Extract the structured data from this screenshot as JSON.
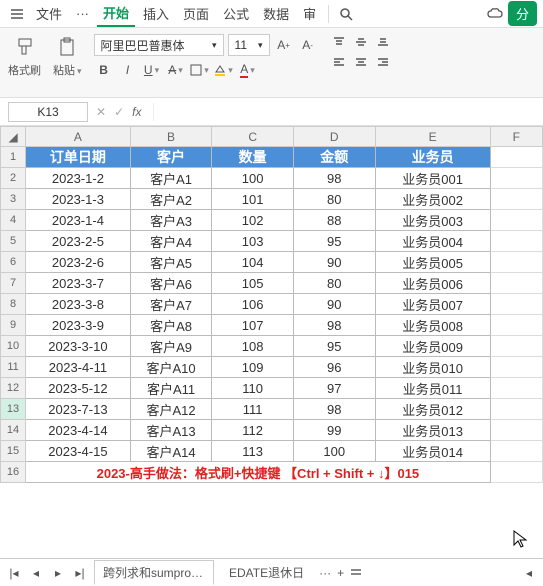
{
  "menu": {
    "items": [
      "文件",
      "···",
      "开始",
      "插入",
      "页面",
      "公式",
      "数据",
      "审"
    ],
    "active_index": 2
  },
  "greenbtn": "分",
  "toolbar": {
    "fmtbrush": "格式刷",
    "paste": "粘贴",
    "font_name": "阿里巴巴普惠体",
    "font_size": "11"
  },
  "namebox": "K13",
  "fx": "fx",
  "columns": [
    "A",
    "B",
    "C",
    "D",
    "E",
    "F"
  ],
  "headers": [
    "订单日期",
    "客户",
    "数量",
    "金额",
    "业务员"
  ],
  "rows": [
    {
      "n": "1"
    },
    {
      "n": "2",
      "a": "2023-1-2",
      "b": "客户A1",
      "c": "100",
      "d": "98",
      "e": "业务员001"
    },
    {
      "n": "3",
      "a": "2023-1-3",
      "b": "客户A2",
      "c": "101",
      "d": "80",
      "e": "业务员002"
    },
    {
      "n": "4",
      "a": "2023-1-4",
      "b": "客户A3",
      "c": "102",
      "d": "88",
      "e": "业务员003"
    },
    {
      "n": "5",
      "a": "2023-2-5",
      "b": "客户A4",
      "c": "103",
      "d": "95",
      "e": "业务员004"
    },
    {
      "n": "6",
      "a": "2023-2-6",
      "b": "客户A5",
      "c": "104",
      "d": "90",
      "e": "业务员005"
    },
    {
      "n": "7",
      "a": "2023-3-7",
      "b": "客户A6",
      "c": "105",
      "d": "80",
      "e": "业务员006"
    },
    {
      "n": "8",
      "a": "2023-3-8",
      "b": "客户A7",
      "c": "106",
      "d": "90",
      "e": "业务员007"
    },
    {
      "n": "9",
      "a": "2023-3-9",
      "b": "客户A8",
      "c": "107",
      "d": "98",
      "e": "业务员008"
    },
    {
      "n": "10",
      "a": "2023-3-10",
      "b": "客户A9",
      "c": "108",
      "d": "95",
      "e": "业务员009"
    },
    {
      "n": "11",
      "a": "2023-4-11",
      "b": "客户A10",
      "c": "109",
      "d": "96",
      "e": "业务员010"
    },
    {
      "n": "12",
      "a": "2023-5-12",
      "b": "客户A11",
      "c": "110",
      "d": "97",
      "e": "业务员011"
    },
    {
      "n": "13",
      "a": "2023-7-13",
      "b": "客户A12",
      "c": "111",
      "d": "98",
      "e": "业务员012"
    },
    {
      "n": "14",
      "a": "2023-4-14",
      "b": "客户A13",
      "c": "112",
      "d": "99",
      "e": "业务员013"
    },
    {
      "n": "15",
      "a": "2023-4-15",
      "b": "客户A14",
      "c": "113",
      "d": "100",
      "e": "业务员014"
    },
    {
      "n": "16",
      "a": "2023-高手做法：格式刷+快捷键 【Ctrl + Shift + ↓】015",
      "red": true
    }
  ],
  "sheets": {
    "active": "跨列求和sumproduct",
    "other": "EDATE退休日"
  }
}
